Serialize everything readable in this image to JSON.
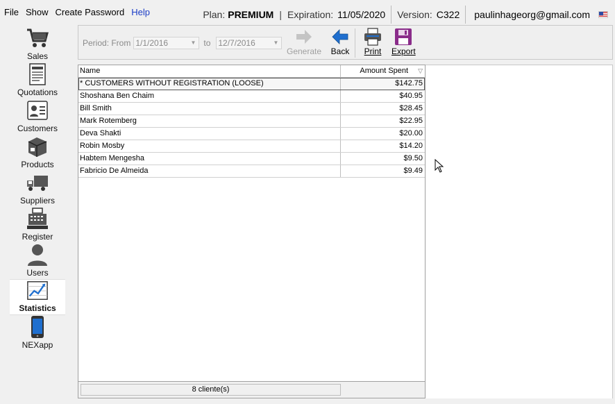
{
  "menu": {
    "file": "File",
    "show": "Show",
    "create_password": "Create Password",
    "help": "Help"
  },
  "info": {
    "plan_label": "Plan:",
    "plan_value": "PREMIUM",
    "expiration_label": "Expiration:",
    "expiration_value": "11/05/2020",
    "version_label": "Version:",
    "version_value": "C322",
    "email": "paulinhageorg@gmail.com",
    "separator": "|"
  },
  "sidebar": {
    "items": [
      {
        "label": "Sales"
      },
      {
        "label": "Quotations"
      },
      {
        "label": "Customers"
      },
      {
        "label": "Products"
      },
      {
        "label": "Suppliers"
      },
      {
        "label": "Register"
      },
      {
        "label": "Users"
      },
      {
        "label": "Statistics"
      },
      {
        "label": "NEXapp"
      }
    ]
  },
  "toolbar": {
    "period_label": "Period: From",
    "from_date": "1/1/2016",
    "to_label": "to",
    "to_date": "12/7/2016",
    "generate": "Generate",
    "back": "Back",
    "print": "Print",
    "export": "Export"
  },
  "table": {
    "columns": [
      "Name",
      "Amount Spent"
    ],
    "rows": [
      {
        "name": "* CUSTOMERS WITHOUT REGISTRATION (LOOSE)",
        "amount": "$142.75"
      },
      {
        "name": "Shoshana Ben Chaim",
        "amount": "$40.95"
      },
      {
        "name": "Bill Smith",
        "amount": "$28.45"
      },
      {
        "name": "Mark Rotemberg",
        "amount": "$22.95"
      },
      {
        "name": "Deva Shakti",
        "amount": "$20.00"
      },
      {
        "name": "Robin Mosby",
        "amount": "$14.20"
      },
      {
        "name": "Habtem Mengesha",
        "amount": "$9.50"
      },
      {
        "name": "Fabricio De Almeida",
        "amount": "$9.49"
      }
    ],
    "footer_count": "8 cliente(s)"
  },
  "colors": {
    "accent_blue": "#1f6fcf",
    "export_purple": "#8a2c8a",
    "help_link": "#1a3cc6"
  }
}
